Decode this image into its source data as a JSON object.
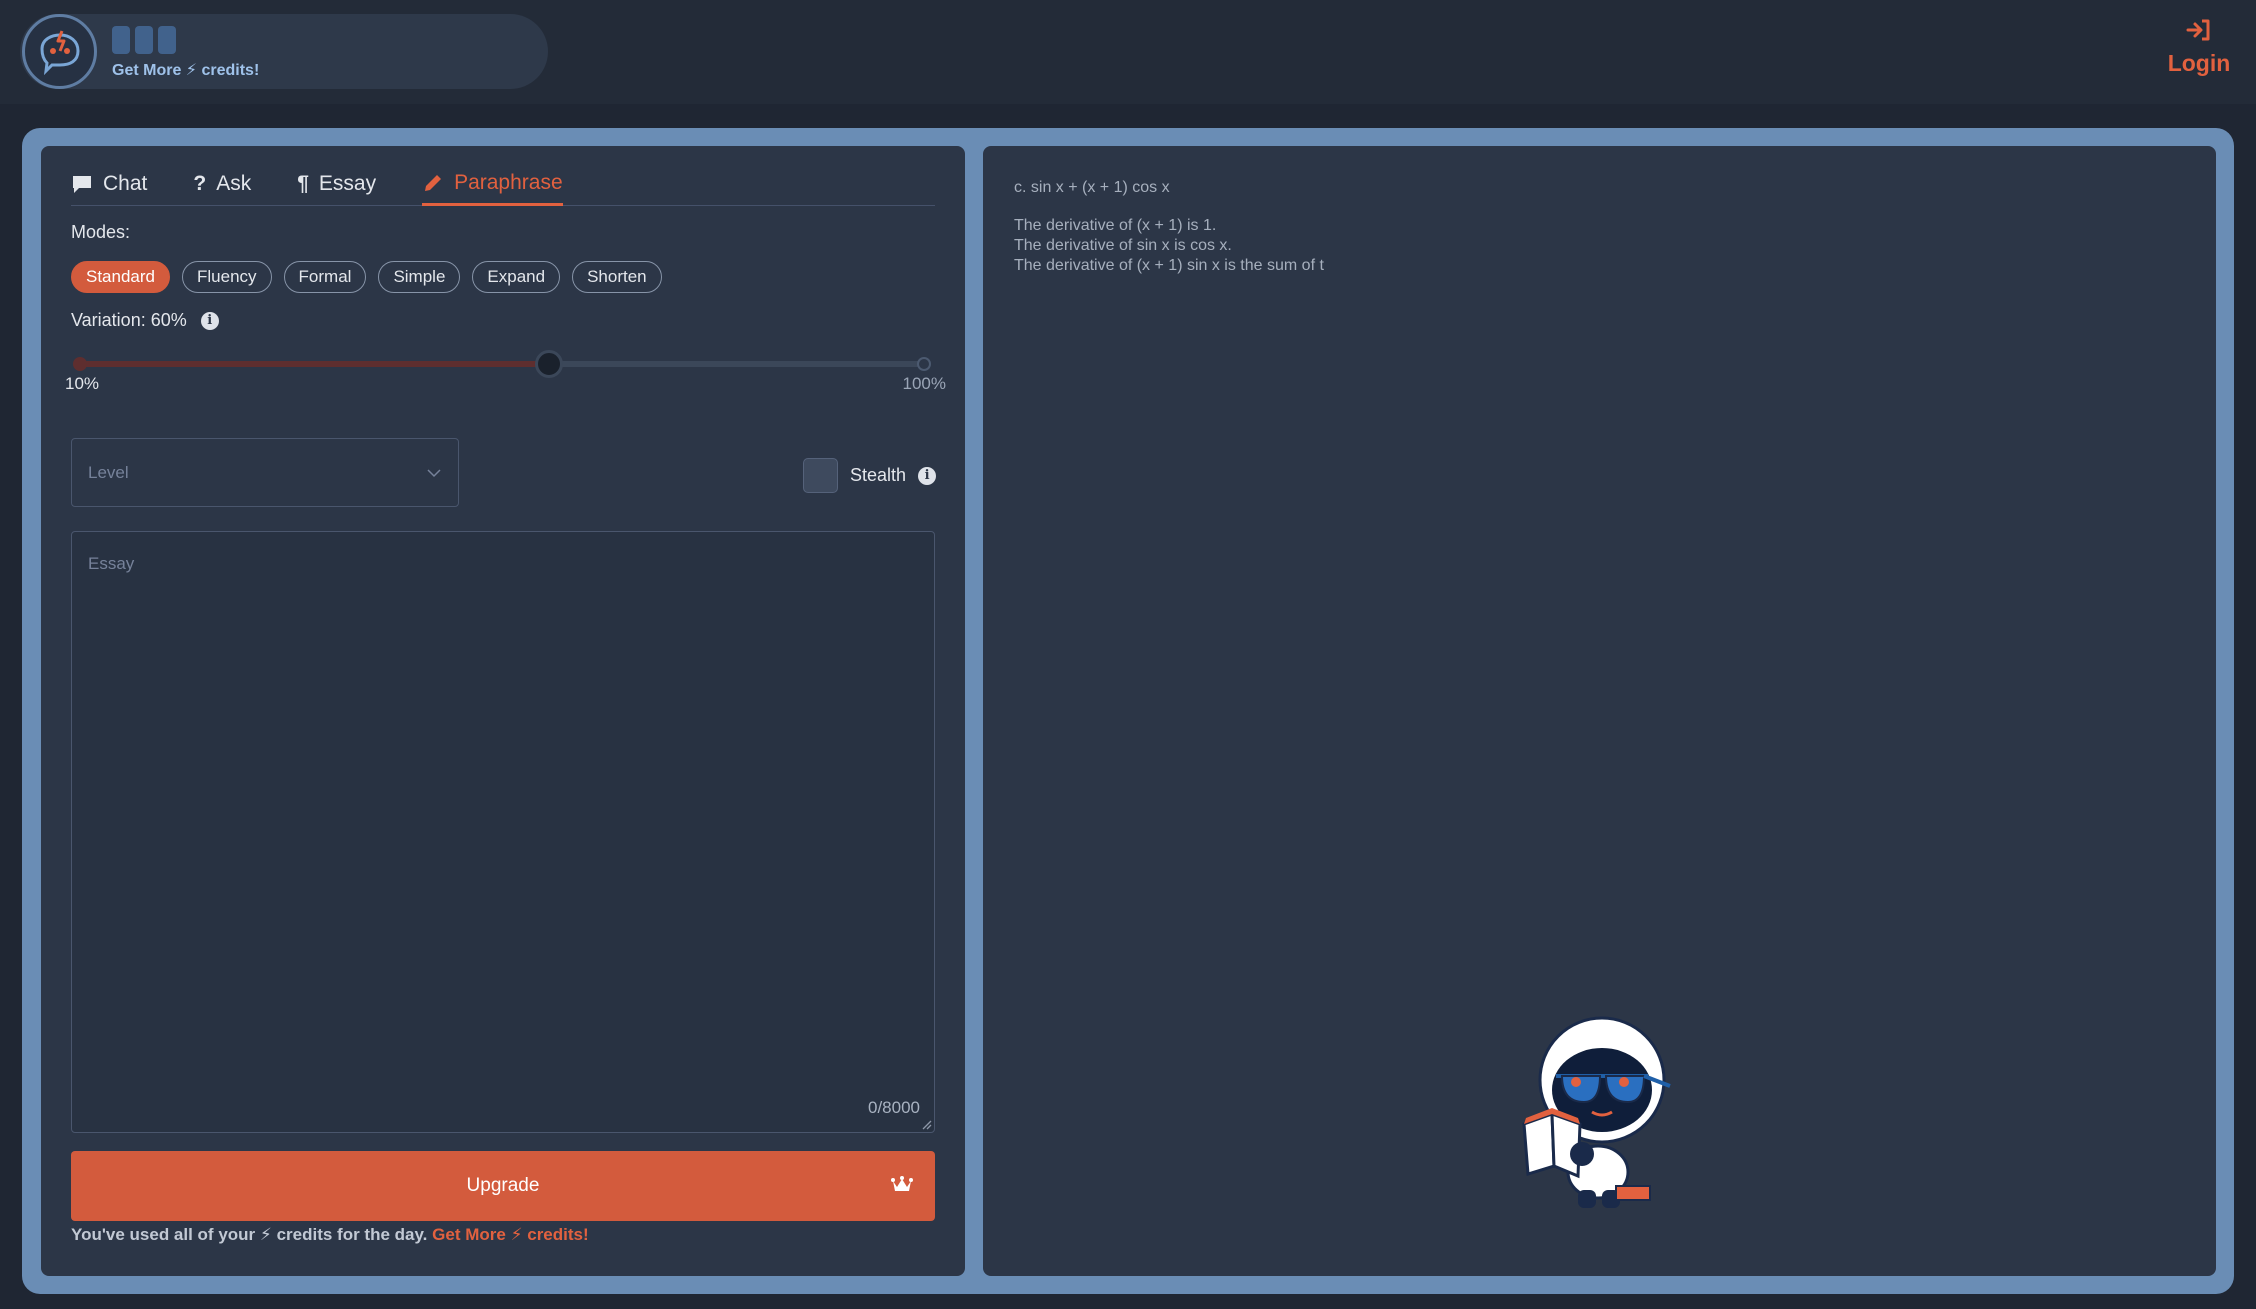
{
  "header": {
    "get_more_prefix": "Get More",
    "get_more_suffix": "credits!",
    "login_label": "Login",
    "credit_bars": 3
  },
  "tabs": [
    {
      "label": "Chat",
      "icon": "chat-icon",
      "active": false
    },
    {
      "label": "Ask",
      "icon": "question-icon",
      "active": false
    },
    {
      "label": "Essay",
      "icon": "paragraph-icon",
      "active": false
    },
    {
      "label": "Paraphrase",
      "icon": "pencil-icon",
      "active": true
    }
  ],
  "modes": {
    "label": "Modes:",
    "items": [
      "Standard",
      "Fluency",
      "Formal",
      "Simple",
      "Expand",
      "Shorten"
    ],
    "selected": "Standard"
  },
  "variation": {
    "label": "Variation: 60%",
    "value_percent": 60,
    "min_label": "10%",
    "max_label": "100%",
    "min": 10,
    "max": 100
  },
  "level": {
    "placeholder": "Level"
  },
  "stealth": {
    "label": "Stealth",
    "checked": false
  },
  "essay": {
    "placeholder": "Essay",
    "counter": "0/8000"
  },
  "upgrade": {
    "label": "Upgrade"
  },
  "credits_note": {
    "prefix": "You've used all of your",
    "middle": "credits for the day.",
    "link_prefix": "Get More",
    "link_suffix": "credits!"
  },
  "output": {
    "line1": "c. sin x + (x + 1) cos x",
    "line2": "The derivative of (x + 1) is 1.",
    "line3": "The derivative of sin x is cos x.",
    "line4": "The derivative of (x + 1) sin x is the sum of t"
  },
  "colors": {
    "accent": "#d35b3d",
    "frame": "#6a8db5",
    "panel": "#2c3647",
    "background": "#1f2633"
  }
}
